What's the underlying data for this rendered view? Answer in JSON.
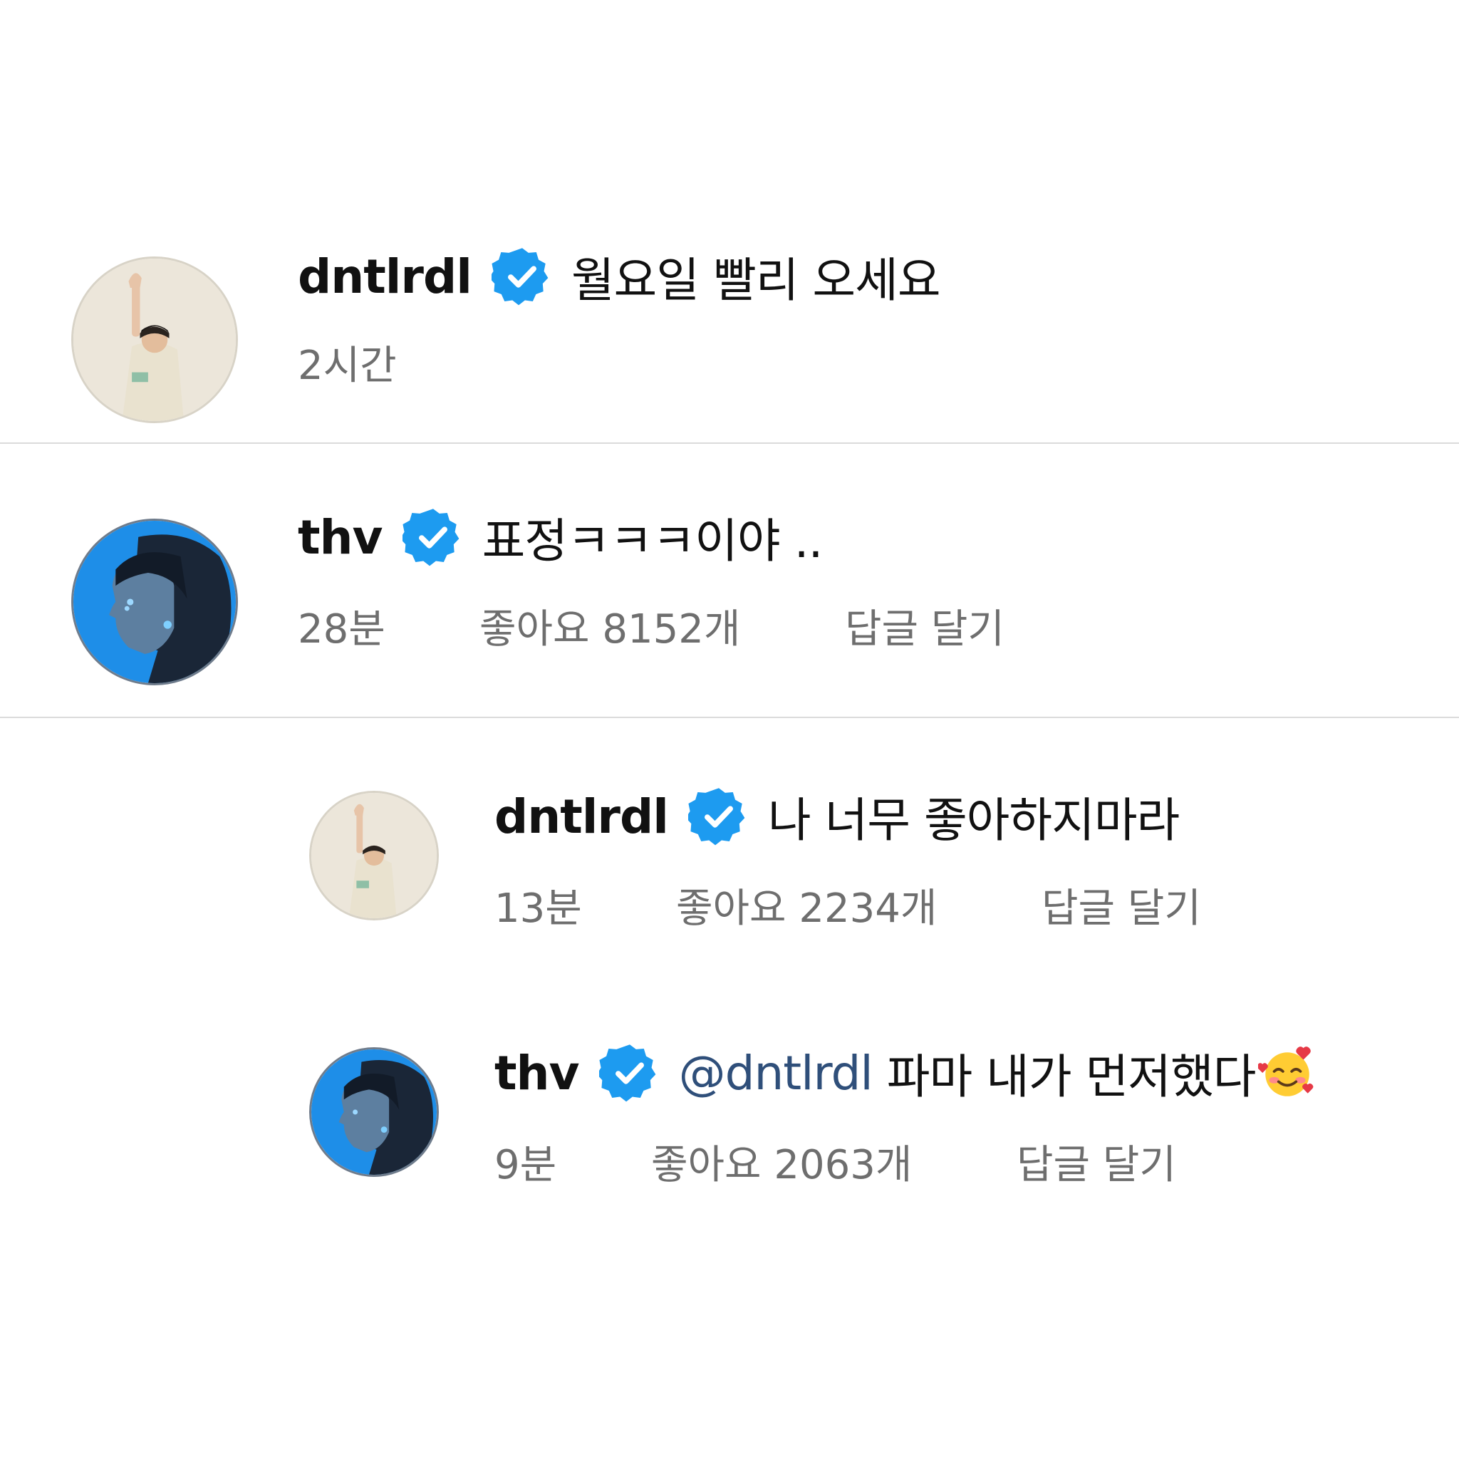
{
  "comments": [
    {
      "username": "dntlrdl",
      "verified": true,
      "text": "월요일 빨리 오세요",
      "time": "2시간",
      "avatar": "dntlrdl-avatar"
    },
    {
      "username": "thv",
      "verified": true,
      "text": "표정ㅋㅋㅋ이야 ..",
      "time": "28분",
      "likes": "좋아요 8152개",
      "reply_label": "답글 달기",
      "avatar": "thv-avatar"
    }
  ],
  "replies": [
    {
      "username": "dntlrdl",
      "verified": true,
      "text": "나 너무 좋아하지마라",
      "time": "13분",
      "likes": "좋아요 2234개",
      "reply_label": "답글 달기",
      "avatar": "dntlrdl-avatar"
    },
    {
      "username": "thv",
      "verified": true,
      "mention": "@dntlrdl",
      "text": "파마 내가 먼저했다",
      "emoji": "smiling-face-with-hearts-icon",
      "time": "9분",
      "likes": "좋아요 2063개",
      "reply_label": "답글 달기",
      "avatar": "thv-avatar"
    }
  ],
  "colors": {
    "verified_badge": "#1d9bf0",
    "mention": "#2f4f7a",
    "meta_text": "#6e6e6e",
    "divider": "#dbdbdb"
  }
}
